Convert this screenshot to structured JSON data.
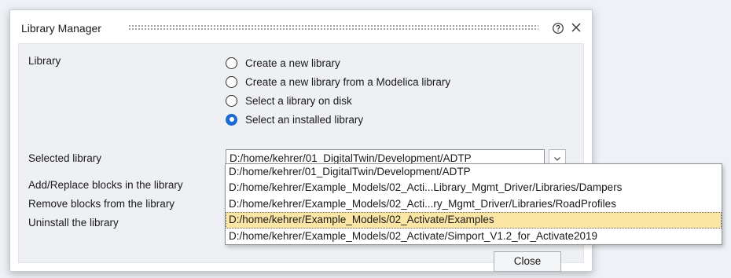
{
  "dialog": {
    "title": "Library Manager",
    "library_label": "Library",
    "radio_options": [
      {
        "label": "Create a new library",
        "checked": false
      },
      {
        "label": "Create a new library from a Modelica library",
        "checked": false
      },
      {
        "label": "Select a library on disk",
        "checked": false
      },
      {
        "label": "Select an installed library",
        "checked": true
      }
    ],
    "selected_library_label": "Selected library",
    "selected_library_value": "D:/home/kehrer/01_DigitalTwin/Development/ADTP",
    "actions": [
      "Add/Replace blocks in the library",
      "Remove blocks from the library",
      "Uninstall the library"
    ],
    "close_label": "Close"
  },
  "dropdown": {
    "selected_index": 3,
    "options": [
      "D:/home/kehrer/01_DigitalTwin/Development/ADTP",
      "D:/home/kehrer/Example_Models/02_Acti...Library_Mgmt_Driver/Libraries/Dampers",
      "D:/home/kehrer/Example_Models/02_Acti...ry_Mgmt_Driver/Libraries/RoadProfiles",
      "D:/home/kehrer/Example_Models/02_Activate/Examples",
      "D:/home/kehrer/Example_Models/02_Activate/Simport_V1.2_for_Activate2019"
    ]
  },
  "colors": {
    "accent": "#1c6bd0",
    "highlight": "#fce6a6",
    "background": "#eef2f6"
  },
  "icons": [
    "help-icon",
    "close-icon",
    "chevron-down-icon"
  ]
}
